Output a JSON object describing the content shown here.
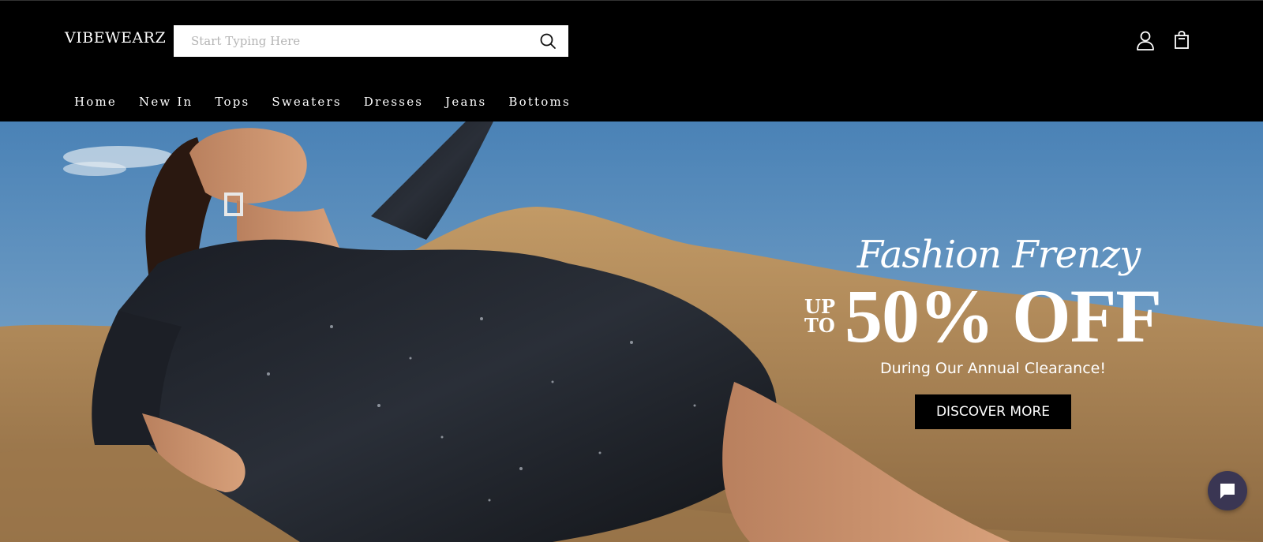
{
  "header": {
    "logo": "VIBEWEARZ",
    "search": {
      "placeholder": "Start Typing Here",
      "value": ""
    },
    "icons": [
      "search-icon",
      "account-icon",
      "shopping-bag-icon"
    ]
  },
  "nav": {
    "items": [
      {
        "label": "Home"
      },
      {
        "label": "New In"
      },
      {
        "label": "Tops"
      },
      {
        "label": "Sweaters"
      },
      {
        "label": "Dresses"
      },
      {
        "label": "Jeans"
      },
      {
        "label": "Bottoms"
      }
    ]
  },
  "hero": {
    "headline": "Fashion Frenzy",
    "upto_line1": "UP",
    "upto_line2": "TO",
    "offer": "50% OFF",
    "subline": "During Our Annual Clearance!",
    "cta_label": "DISCOVER MORE",
    "image_description_icon": "model-sequin-dress-photo"
  },
  "chat": {
    "icon": "chat-bubble-icon"
  },
  "colors": {
    "header_bg": "#000000",
    "cta_bg": "#000000",
    "chat_bg": "#3a3653",
    "text_light": "#ffffff"
  }
}
